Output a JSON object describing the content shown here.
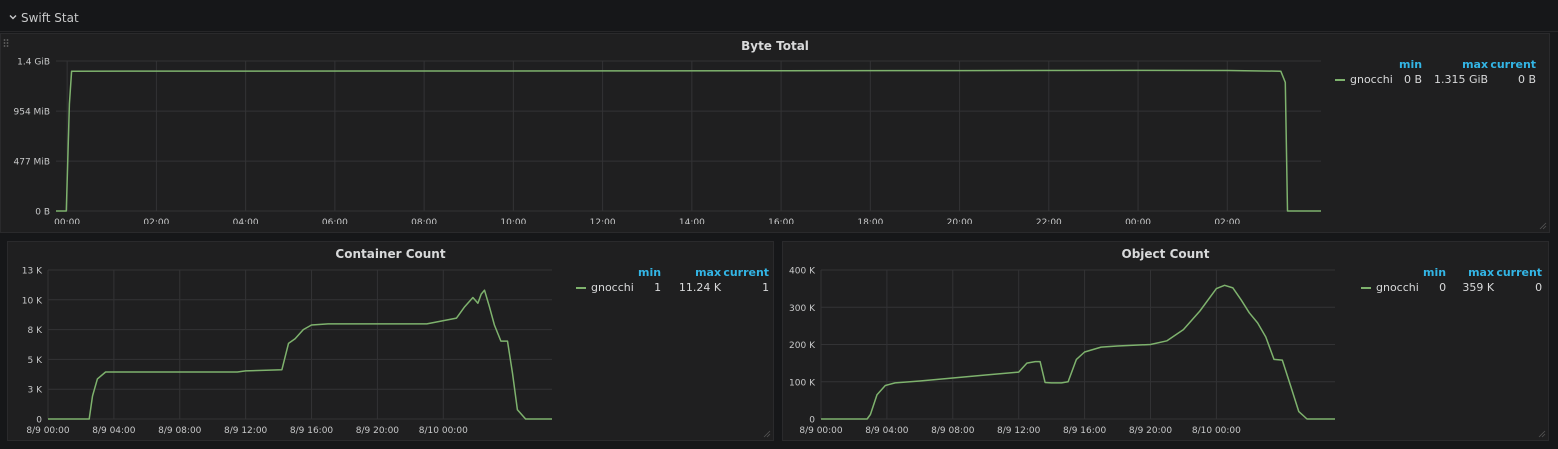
{
  "row": {
    "title": "Swift Stat"
  },
  "colors": {
    "series": "#7eb26d",
    "legend_header": "#33b5e5",
    "grid": "#333335",
    "text": "#d8d9da"
  },
  "legend_headers": {
    "min": "min",
    "max": "max",
    "current": "current"
  },
  "panels": {
    "byte_total": {
      "title": "Byte Total",
      "legend": {
        "name": "gnocchi",
        "min": "0 B",
        "max": "1.315 GiB",
        "current": "0 B"
      }
    },
    "container_count": {
      "title": "Container Count",
      "legend": {
        "name": "gnocchi",
        "min": "1",
        "max": "11.24 K",
        "current": "1"
      }
    },
    "object_count": {
      "title": "Object Count",
      "legend": {
        "name": "gnocchi",
        "min": "0",
        "max": "359 K",
        "current": "0"
      }
    }
  },
  "chart_data": [
    {
      "type": "line",
      "title": "Byte Total",
      "y_tick_labels": [
        "0 B",
        "477 MiB",
        "954 MiB",
        "1.4 GiB"
      ],
      "y_ticks_gib": [
        0,
        0.4658,
        0.9316,
        1.4
      ],
      "ylim_gib": [
        0,
        1.4
      ],
      "x_tick_labels": [
        "00:00",
        "02:00",
        "04:00",
        "06:00",
        "08:00",
        "10:00",
        "12:00",
        "14:00",
        "16:00",
        "18:00",
        "20:00",
        "22:00",
        "00:00",
        "02:00"
      ],
      "x_hours": [
        0,
        2,
        4,
        6,
        8,
        10,
        12,
        14,
        16,
        18,
        20,
        22,
        24,
        26
      ],
      "xlim_hours": [
        -0.25,
        28.1
      ],
      "series": [
        {
          "name": "gnocchi",
          "x_hours": [
            -0.25,
            -0.02,
            0.05,
            0.1,
            4,
            8,
            12,
            16,
            20,
            24,
            26,
            27.2,
            27.3,
            27.35,
            28.1
          ],
          "values_gib": [
            0,
            0,
            1.0,
            1.305,
            1.306,
            1.307,
            1.308,
            1.309,
            1.31,
            1.312,
            1.311,
            1.305,
            1.2,
            0,
            0
          ]
        }
      ],
      "grid": true,
      "legend_placement": "right"
    },
    {
      "type": "line",
      "title": "Container Count",
      "y_tick_labels": [
        "0",
        "3 K",
        "5 K",
        "8 K",
        "10 K",
        "13 K"
      ],
      "y_ticks_k": [
        0,
        2.6,
        5.2,
        7.8,
        10.4,
        13
      ],
      "ylim_k": [
        0,
        13
      ],
      "x_tick_labels": [
        "8/9 00:00",
        "8/9 04:00",
        "8/9 08:00",
        "8/9 12:00",
        "8/9 16:00",
        "8/9 20:00",
        "8/10 00:00"
      ],
      "x_hours": [
        0,
        4,
        8,
        12,
        16,
        20,
        24
      ],
      "xlim_hours": [
        0,
        30.6
      ],
      "series": [
        {
          "name": "gnocchi",
          "x_hours": [
            0,
            2.5,
            2.7,
            3,
            3.5,
            4,
            8,
            11.5,
            12,
            14.2,
            14.6,
            15,
            15.5,
            16,
            17,
            20,
            23,
            24.8,
            25.3,
            25.8,
            26.1,
            26.3,
            26.5,
            26.8,
            27.1,
            27.5,
            27.9,
            28.2,
            28.5,
            29,
            30.6
          ],
          "values_k": [
            0,
            0,
            2,
            3.5,
            4.1,
            4.1,
            4.1,
            4.1,
            4.2,
            4.3,
            6.6,
            7,
            7.8,
            8.2,
            8.3,
            8.3,
            8.3,
            8.8,
            9.8,
            10.6,
            10.1,
            10.9,
            11.24,
            9.8,
            8.2,
            6.8,
            6.8,
            4.0,
            0.8,
            0,
            0
          ]
        }
      ],
      "grid": true,
      "legend_placement": "right"
    },
    {
      "type": "line",
      "title": "Object Count",
      "y_tick_labels": [
        "0",
        "100 K",
        "200 K",
        "300 K",
        "400 K"
      ],
      "y_ticks_k": [
        0,
        100,
        200,
        300,
        400
      ],
      "ylim_k": [
        0,
        400
      ],
      "x_tick_labels": [
        "8/9 00:00",
        "8/9 04:00",
        "8/9 08:00",
        "8/9 12:00",
        "8/9 16:00",
        "8/9 20:00",
        "8/10 00:00"
      ],
      "x_hours": [
        0,
        4,
        8,
        12,
        16,
        20,
        24
      ],
      "xlim_hours": [
        0,
        31.2
      ],
      "series": [
        {
          "name": "gnocchi",
          "x_hours": [
            0,
            2.8,
            3,
            3.4,
            3.9,
            4.5,
            6,
            8,
            10,
            12,
            12.5,
            13,
            13.3,
            13.6,
            14,
            14.6,
            15,
            15.5,
            16,
            17,
            18,
            20,
            21,
            22,
            23,
            24,
            24.5,
            25,
            25.5,
            26,
            26.5,
            27,
            27.5,
            28,
            28.5,
            29,
            29.5,
            31.2
          ],
          "values_k": [
            0,
            0,
            12,
            65,
            90,
            97,
            102,
            110,
            118,
            126,
            150,
            154,
            154,
            98,
            97,
            97,
            100,
            160,
            180,
            193,
            196,
            200,
            210,
            240,
            290,
            350,
            359,
            352,
            320,
            285,
            258,
            220,
            160,
            158,
            90,
            20,
            0,
            0
          ]
        }
      ],
      "grid": true,
      "legend_placement": "right"
    }
  ]
}
